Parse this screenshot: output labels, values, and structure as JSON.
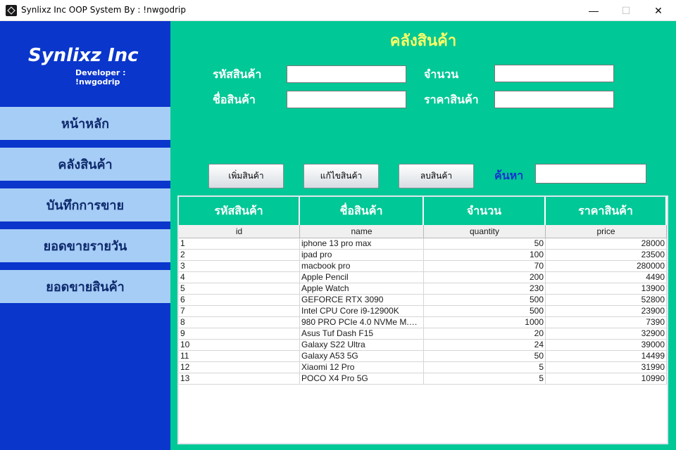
{
  "window": {
    "title": "Synlixz Inc OOP System By : !nwgodrip",
    "min": "—",
    "max": "☐",
    "close": "✕"
  },
  "sidebar": {
    "brand": "Synlixz Inc",
    "developer": "Developer : !nwgodrip",
    "items": [
      {
        "label": "หน้าหลัก"
      },
      {
        "label": "คลังสินค้า"
      },
      {
        "label": "บันทึกการขาย"
      },
      {
        "label": "ยอดขายรายวัน"
      },
      {
        "label": "ยอดขายสินค้า"
      }
    ]
  },
  "main": {
    "title": "คลังสินค้า",
    "form": {
      "code_label": "รหัสสินค้า",
      "code_value": "",
      "name_label": "ชื่อสินค้า",
      "name_value": "",
      "qty_label": "จำนวน",
      "qty_value": "",
      "price_label": "ราคาสินค้า",
      "price_value": ""
    },
    "buttons": {
      "add": "เพิ่มสินค้า",
      "edit": "แก้ไขสินค้า",
      "delete": "ลบสินค้า"
    },
    "search": {
      "label": "ค้นหา",
      "value": ""
    }
  },
  "table": {
    "thai_headers": [
      "รหัสสินค้า",
      "ชื่อสินค้า",
      "จำนวน",
      "ราคาสินค้า"
    ],
    "columns": [
      "id",
      "name",
      "quantity",
      "price"
    ],
    "rows": [
      [
        "1",
        "iphone 13 pro max",
        "50",
        "28000"
      ],
      [
        "2",
        "ipad pro",
        "100",
        "23500"
      ],
      [
        "3",
        "macbook pro",
        "70",
        "280000"
      ],
      [
        "4",
        "Apple Pencil",
        "200",
        "4490"
      ],
      [
        "5",
        "Apple Watch",
        "230",
        "13900"
      ],
      [
        "6",
        "GEFORCE RTX 3090",
        "500",
        "52800"
      ],
      [
        "7",
        "Intel CPU Core i9-12900K",
        "500",
        "23900"
      ],
      [
        "8",
        "980 PRO PCIe 4.0 NVMe M.2 ...",
        "1000",
        "7390"
      ],
      [
        "9",
        "Asus Tuf Dash F15",
        "20",
        "32900"
      ],
      [
        "10",
        "Galaxy S22 Ultra",
        "24",
        "39000"
      ],
      [
        "11",
        "Galaxy A53 5G",
        "50",
        "14499"
      ],
      [
        "12",
        "Xiaomi 12 Pro",
        "5",
        "31990"
      ],
      [
        "13",
        "POCO X4 Pro 5G",
        "5",
        "10990"
      ]
    ]
  }
}
